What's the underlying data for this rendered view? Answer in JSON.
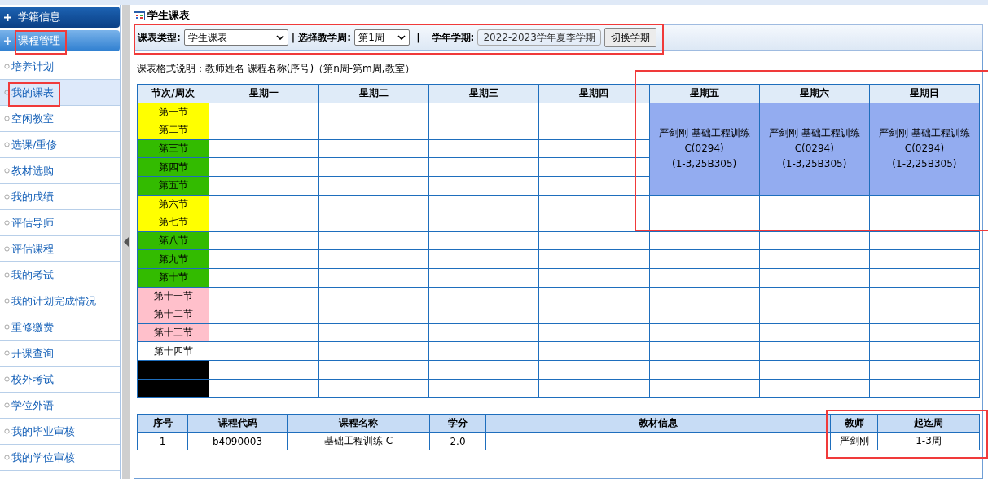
{
  "sidebar": {
    "sections": [
      {
        "title": "学籍信息",
        "expanded": false,
        "highlighted": false
      },
      {
        "title": "课程管理",
        "expanded": true,
        "highlighted": true,
        "items": [
          {
            "label": "培养计划",
            "selected": false,
            "highlighted": false
          },
          {
            "label": "我的课表",
            "selected": true,
            "highlighted": true
          },
          {
            "label": "空闲教室",
            "selected": false,
            "highlighted": false
          },
          {
            "label": "选课/重修",
            "selected": false,
            "highlighted": false
          },
          {
            "label": "教材选购",
            "selected": false,
            "highlighted": false
          },
          {
            "label": "我的成绩",
            "selected": false,
            "highlighted": false
          },
          {
            "label": "评估导师",
            "selected": false,
            "highlighted": false
          },
          {
            "label": "评估课程",
            "selected": false,
            "highlighted": false
          },
          {
            "label": "我的考试",
            "selected": false,
            "highlighted": false
          },
          {
            "label": "我的计划完成情况",
            "selected": false,
            "highlighted": false
          },
          {
            "label": "重修缴费",
            "selected": false,
            "highlighted": false
          },
          {
            "label": "开课查询",
            "selected": false,
            "highlighted": false
          },
          {
            "label": "校外考试",
            "selected": false,
            "highlighted": false
          },
          {
            "label": "学位外语",
            "selected": false,
            "highlighted": false
          },
          {
            "label": "我的毕业审核",
            "selected": false,
            "highlighted": false
          },
          {
            "label": "我的学位审核",
            "selected": false,
            "highlighted": false
          }
        ]
      }
    ]
  },
  "page_title": "学生课表",
  "toolbar": {
    "highlighted": true,
    "type_label": "课表类型:",
    "type_value": "学生课表",
    "week_label": "| 选择教学周:",
    "week_value": "第1周",
    "separator": "|",
    "term_label": "学年学期:",
    "term_value": "2022-2023学年夏季学期",
    "switch_button": "切换学期"
  },
  "legend": "课表格式说明：教师姓名  课程名称(序号)（第n周-第m周,教室）",
  "timetable": {
    "corner": "节次/周次",
    "courses_highlighted": true,
    "days": [
      {
        "label": "星期一"
      },
      {
        "label": "星期二"
      },
      {
        "label": "星期三"
      },
      {
        "label": "星期四"
      },
      {
        "label": "星期五",
        "course": [
          "严剑刚 基础工程训练",
          "C(0294)",
          "(1-3,25B305)"
        ]
      },
      {
        "label": "星期六",
        "course": [
          "严剑刚 基础工程训练",
          "C(0294)",
          "(1-3,25B305)"
        ]
      },
      {
        "label": "星期日",
        "course": [
          "严剑刚 基础工程训练",
          "C(0294)",
          "(1-2,25B305)"
        ]
      }
    ],
    "periods": [
      {
        "label": "第一节",
        "color": "#ffff00"
      },
      {
        "label": "第二节",
        "color": "#ffff00"
      },
      {
        "label": "第三节",
        "color": "#33bb00"
      },
      {
        "label": "第四节",
        "color": "#33bb00"
      },
      {
        "label": "第五节",
        "color": "#33bb00"
      },
      {
        "label": "第六节",
        "color": "#ffff00"
      },
      {
        "label": "第七节",
        "color": "#ffff00"
      },
      {
        "label": "第八节",
        "color": "#33bb00"
      },
      {
        "label": "第九节",
        "color": "#33bb00"
      },
      {
        "label": "第十节",
        "color": "#33bb00"
      },
      {
        "label": "第十一节",
        "color": "#ffc0cb"
      },
      {
        "label": "第十二节",
        "color": "#ffc0cb"
      },
      {
        "label": "第十三节",
        "color": "#ffc0cb"
      },
      {
        "label": "第十四节",
        "color": "#ffffff"
      },
      {
        "color": "#000000"
      },
      {
        "color": "#000000"
      }
    ]
  },
  "course_list": {
    "columns": [
      "序号",
      "课程代码",
      "课程名称",
      "学分",
      "教材信息"
    ],
    "annotated_columns": {
      "highlighted": true,
      "columns": [
        "教师",
        "起迄周"
      ]
    },
    "rows": [
      {
        "cells": [
          "1",
          "b4090003",
          "基础工程训练 C",
          "2.0",
          null,
          "严剑刚",
          "1-3周"
        ]
      }
    ]
  }
}
